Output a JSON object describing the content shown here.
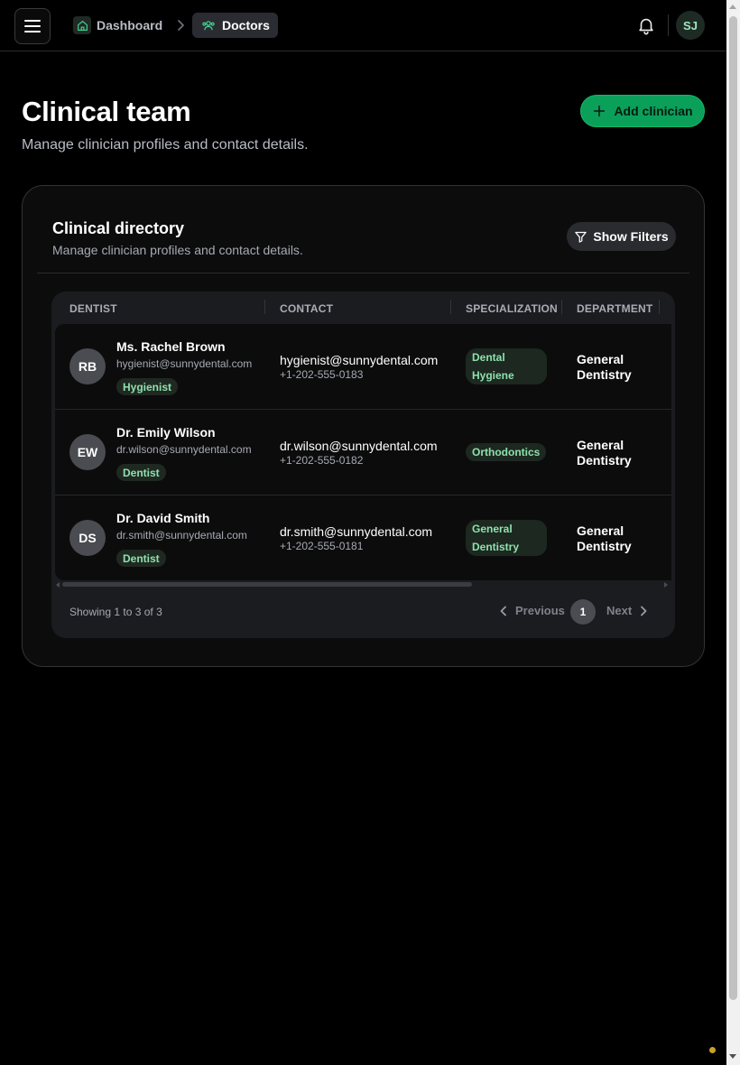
{
  "topbar": {
    "breadcrumbs": [
      {
        "label": "Dashboard",
        "icon": "home-icon"
      },
      {
        "label": "Doctors",
        "icon": "users-icon"
      }
    ],
    "user_initials": "SJ"
  },
  "header": {
    "title": "Clinical team",
    "subtitle": "Manage clinician profiles and contact details.",
    "add_button": "Add clinician"
  },
  "directory": {
    "title": "Clinical directory",
    "subtitle": "Manage clinician profiles and contact details.",
    "filters_button": "Show Filters",
    "columns": [
      "DENTIST",
      "CONTACT",
      "SPECIALIZATION",
      "DEPARTMENT"
    ],
    "rows": [
      {
        "initials": "RB",
        "name": "Ms. Rachel Brown",
        "email": "hygienist@sunnydental.com",
        "role": "Hygienist",
        "contact_email": "hygienist@sunnydental.com",
        "phone": "+1-202-555-0183",
        "specialization": "Dental Hygiene",
        "department": "General Dentistry"
      },
      {
        "initials": "EW",
        "name": "Dr. Emily Wilson",
        "email": "dr.wilson@sunnydental.com",
        "role": "Dentist",
        "contact_email": "dr.wilson@sunnydental.com",
        "phone": "+1-202-555-0182",
        "specialization": "Orthodontics",
        "department": "General Dentistry"
      },
      {
        "initials": "DS",
        "name": "Dr. David Smith",
        "email": "dr.smith@sunnydental.com",
        "role": "Dentist",
        "contact_email": "dr.smith@sunnydental.com",
        "phone": "+1-202-555-0181",
        "specialization": "General Dentistry",
        "department": "General Dentistry"
      }
    ],
    "pagination": {
      "showing": "Showing 1 to 3 of 3",
      "previous": "Previous",
      "current_page": "1",
      "next": "Next"
    }
  },
  "colors": {
    "accent": "#0aa05a",
    "tag_text": "#8fe0ad",
    "background": "#000000"
  }
}
